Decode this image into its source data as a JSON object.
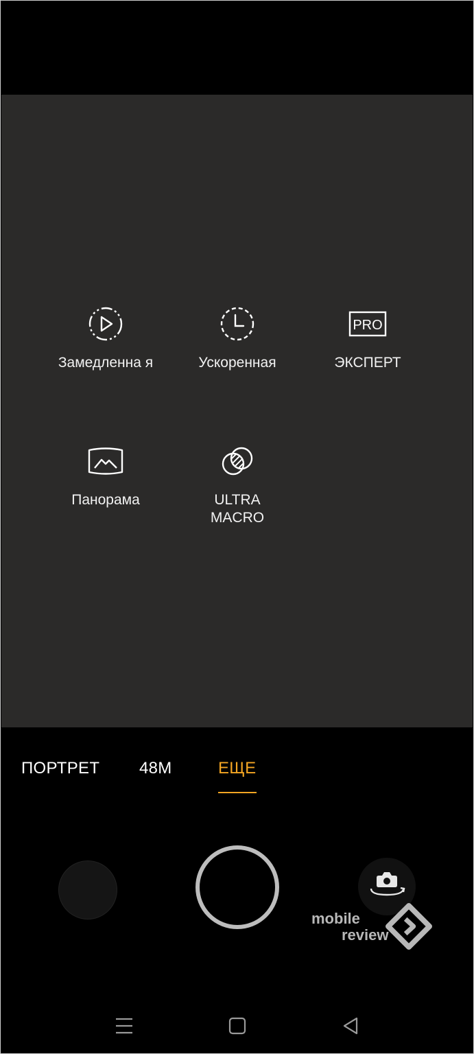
{
  "modes": [
    {
      "id": "slowmo",
      "label": "Замедленна я",
      "icon": "slow-motion-icon"
    },
    {
      "id": "timelapse",
      "label": "Ускоренная",
      "icon": "timelapse-icon"
    },
    {
      "id": "expert",
      "label": "ЭКСПЕРТ",
      "icon": "pro-icon",
      "icon_text": "PRO"
    },
    {
      "id": "panorama",
      "label": "Панорама",
      "icon": "panorama-icon"
    },
    {
      "id": "macro",
      "label": "ULTRA MACRO",
      "icon": "ultra-macro-icon"
    }
  ],
  "tabs": [
    {
      "label": "ПОРТРЕТ",
      "active": false
    },
    {
      "label": "48M",
      "active": false
    },
    {
      "label": "ЕЩЕ",
      "active": true
    }
  ],
  "watermark": {
    "line1": "mobile",
    "line2": "review"
  },
  "colors": {
    "accent": "#f5a623",
    "viewfinder": "#2b2a29",
    "background": "#000000"
  },
  "nav": [
    "menu-icon",
    "home-icon",
    "back-icon"
  ]
}
